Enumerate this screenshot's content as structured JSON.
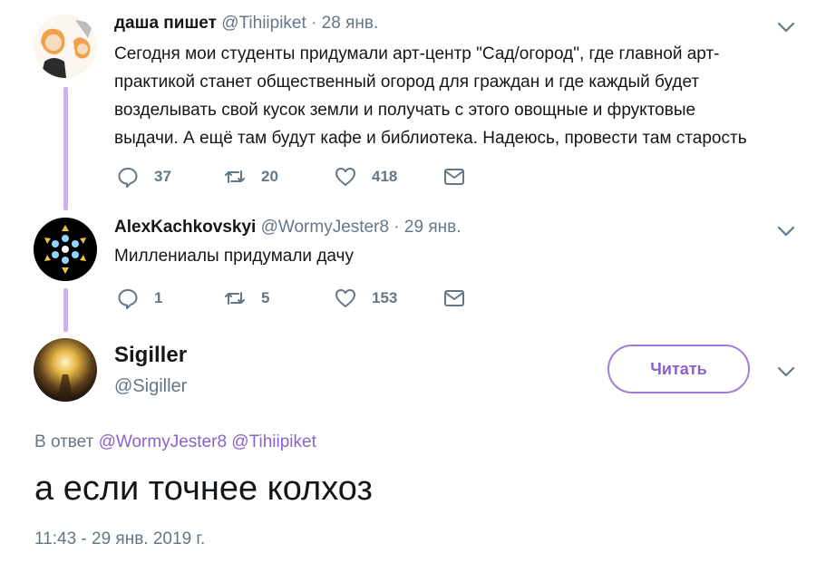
{
  "colors": {
    "accent": "#8b62cc",
    "thread_line": "#c9b3e8",
    "muted": "#657786",
    "text": "#14171a"
  },
  "tweets": [
    {
      "name": "даша пишет",
      "handle": "@Tihiipiket",
      "separator": "·",
      "date": "28 янв.",
      "text_lines": [
        "Сегодня мои студенты придумали арт-центр \"Сад/огород\", где главной арт-",
        "практикой станет общественный огород для граждан и где каждый будет",
        "возделывать свой кусок земли и получать с этого овощные и фруктовые",
        "выдачи. А ещё там будут кафе и библиотека. Надеюсь, провести там старость"
      ],
      "replies": "37",
      "retweets": "20",
      "likes": "418"
    },
    {
      "name": "AlexKachkovskyi",
      "handle": "@WormyJester8",
      "separator": "·",
      "date": "29 янв.",
      "text_lines": [
        "Миллениалы придумали дачу"
      ],
      "replies": "1",
      "retweets": "5",
      "likes": "153"
    }
  ],
  "main_tweet": {
    "name": "Sigiller",
    "handle": "@Sigiller",
    "follow_label": "Читать",
    "reply_prefix": "В ответ",
    "mentions": [
      "@WormyJester8",
      "@Tihiipiket"
    ],
    "text": "а если точнее колхоз",
    "timestamp": "11:43 - 29 янв. 2019 г."
  },
  "icons": {
    "reply": "reply-bubble-icon",
    "retweet": "retweet-icon",
    "like": "heart-icon",
    "dm": "envelope-icon",
    "menu": "chevron-down-icon"
  }
}
